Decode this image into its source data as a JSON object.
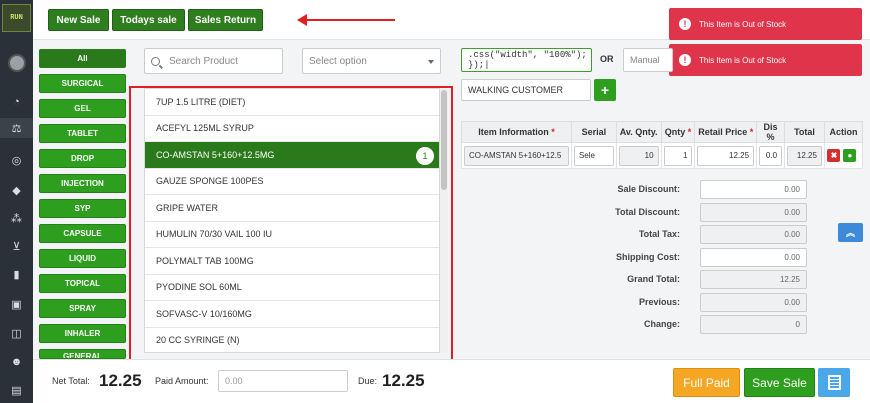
{
  "topbar": {
    "new_sale": "New Sale",
    "todays_sale": "Todays sale",
    "sales_return": "Sales Return"
  },
  "toasts": [
    {
      "text": "This Item is Out of Stock"
    },
    {
      "text": "This Item is Out of Stock"
    }
  ],
  "categories": [
    "All",
    "SURGICAL",
    "GEL",
    "TABLET",
    "DROP",
    "INJECTION",
    "SYP",
    "CAPSULE",
    "LIQUID",
    "TOPICAL",
    "SPRAY",
    "INHALER",
    "GENERAL"
  ],
  "search": {
    "placeholder": "Search Product"
  },
  "select": {
    "placeholder": "Select option"
  },
  "products": [
    {
      "name": "7UP 1.5 LITRE (DIET)"
    },
    {
      "name": "ACEFYL 125ML SYRUP"
    },
    {
      "name": "CO-AMSTAN 5+160+12.5MG",
      "badge": "1"
    },
    {
      "name": "GAUZE SPONGE 100PES"
    },
    {
      "name": "GRIPE WATER"
    },
    {
      "name": "HUMULIN 70/30 VAIL 100 IU"
    },
    {
      "name": "POLYMALT TAB 100MG"
    },
    {
      "name": "PYODINE SOL 60ML"
    },
    {
      "name": "SOFVASC-V 10/160MG"
    },
    {
      "name": "20 CC SYRINGE (N)"
    }
  ],
  "scan": {
    "value": ".css(\"width\", \"100%\");   });|"
  },
  "or_label": "OR",
  "manual": {
    "placeholder": "Manual"
  },
  "customer": {
    "value": "WALKING CUSTOMER"
  },
  "add_button": "+",
  "table": {
    "headers": [
      "Item Information",
      "Serial",
      "Av. Qnty.",
      "Qnty",
      "Retail Price",
      "Dis %",
      "Total",
      "Action"
    ],
    "required_mark": "*",
    "rows": [
      {
        "item": "CO-AMSTAN 5+160+12.5",
        "serial": "Sele",
        "avail": "10",
        "qty": "1",
        "price": "12.25",
        "dis": "0.0",
        "total": "12.25"
      }
    ]
  },
  "summary": [
    {
      "label": "Sale Discount:",
      "value": "0.00"
    },
    {
      "label": "Total Discount:",
      "value": "0.00"
    },
    {
      "label": "Total Tax:",
      "value": "0.00"
    },
    {
      "label": "Shipping Cost:",
      "value": "0.00"
    },
    {
      "label": "Grand Total:",
      "value": "12.25"
    },
    {
      "label": "Previous:",
      "value": "0.00"
    },
    {
      "label": "Change:",
      "value": "0"
    }
  ],
  "footer": {
    "net_total_label": "Net Total:",
    "net_total": "12.25",
    "paid_label": "Paid Amount:",
    "paid_placeholder": "0.00",
    "due_label": "Due:",
    "due": "12.25",
    "full_paid": "Full Paid",
    "save_sale": "Save Sale"
  },
  "logo_text": "RUN",
  "colors": {
    "primary_green": "#2e9e1e",
    "toast_red": "#e0344a",
    "full_paid_orange": "#f5a623",
    "calc_blue": "#4aa8e8"
  }
}
